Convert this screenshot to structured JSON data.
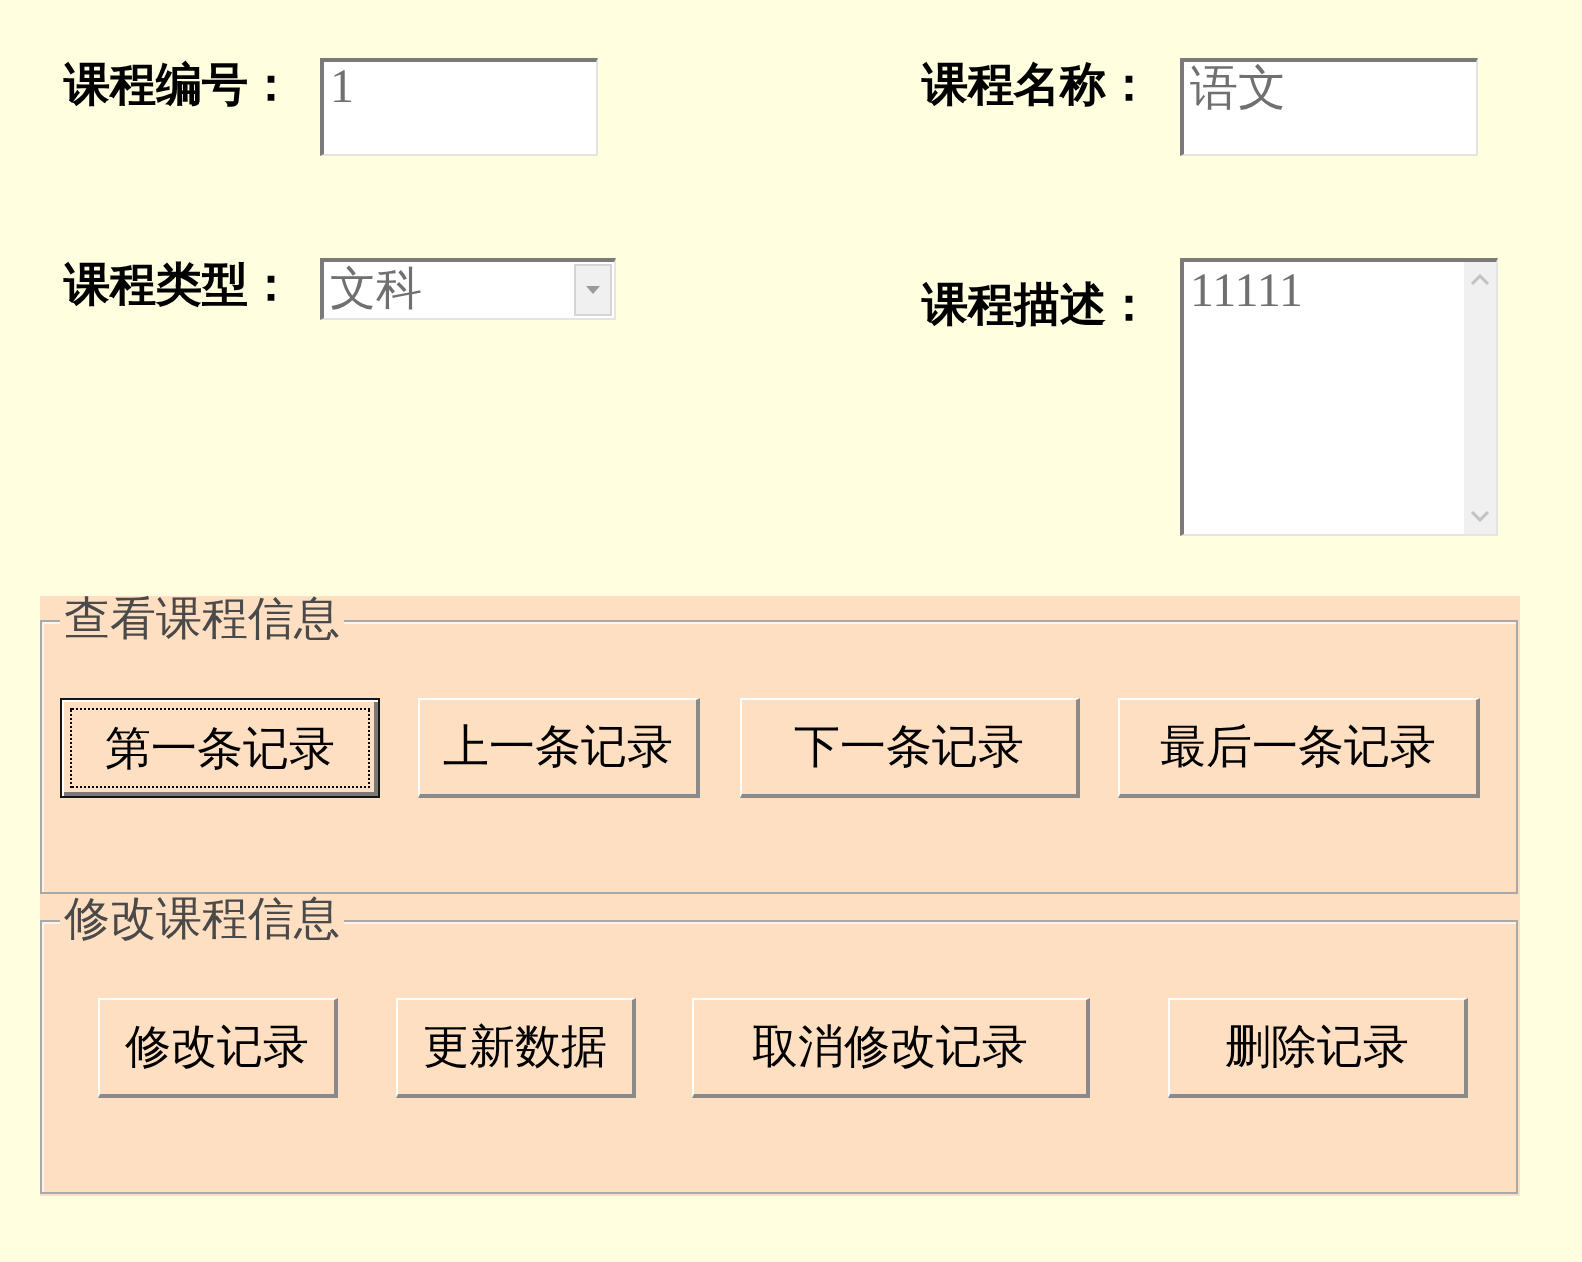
{
  "fields": [
    {
      "kind": "text",
      "label": "课程编号：",
      "value": "1"
    },
    {
      "kind": "text",
      "label": "课程名称：",
      "value": "语文"
    },
    {
      "kind": "select",
      "label": "课程类型：",
      "value": "文科"
    },
    {
      "kind": "textarea",
      "label": "课程描述：",
      "value": "11111"
    }
  ],
  "groups": [
    {
      "legend": "查看课程信息",
      "buttons": [
        {
          "label": "第一条记录",
          "focused": true
        },
        {
          "label": "上一条记录",
          "focused": false
        },
        {
          "label": "下一条记录",
          "focused": false
        },
        {
          "label": "最后一条记录",
          "focused": false
        }
      ]
    },
    {
      "legend": "修改课程信息",
      "buttons": [
        {
          "label": "修改记录",
          "focused": false
        },
        {
          "label": "更新数据",
          "focused": false
        },
        {
          "label": "取消修改记录",
          "focused": false
        },
        {
          "label": "删除记录",
          "focused": false
        }
      ]
    }
  ]
}
